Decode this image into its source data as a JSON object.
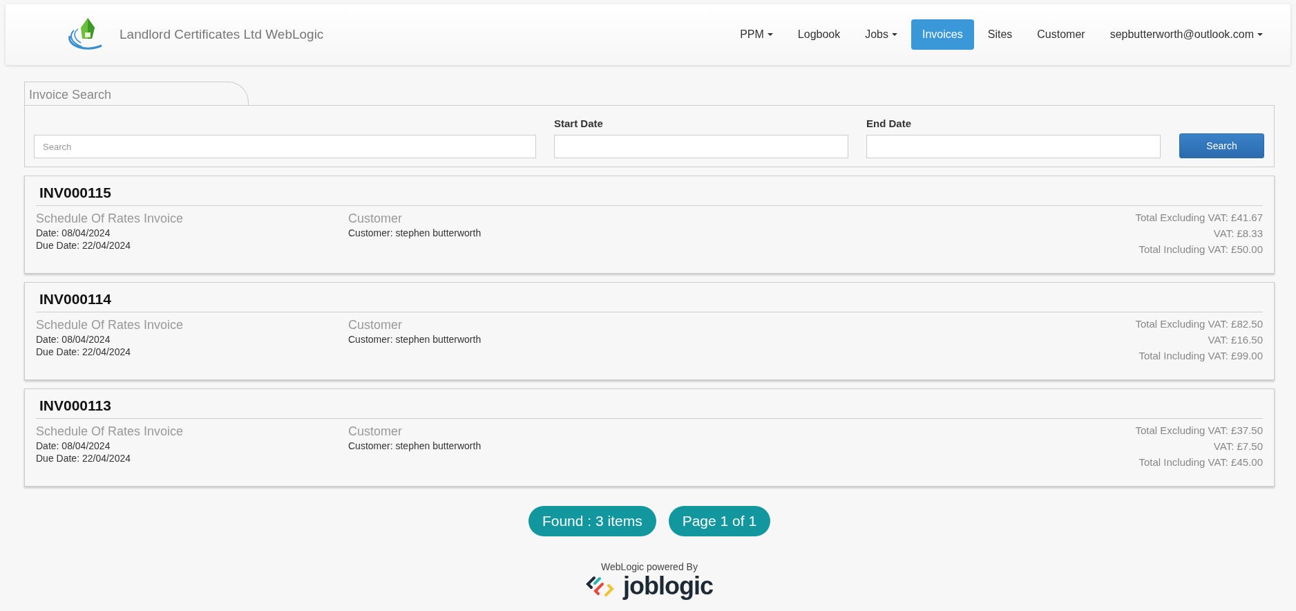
{
  "header": {
    "company": "Landlord Certificates Ltd WebLogic"
  },
  "nav": [
    {
      "label": "PPM",
      "dropdown": true,
      "selected": false
    },
    {
      "label": "Logbook",
      "dropdown": false,
      "selected": false
    },
    {
      "label": "Jobs",
      "dropdown": true,
      "selected": false
    },
    {
      "label": "Invoices",
      "dropdown": false,
      "selected": true
    },
    {
      "label": "Sites",
      "dropdown": false,
      "selected": false
    },
    {
      "label": "Customer",
      "dropdown": false,
      "selected": false
    },
    {
      "label": "sepbutterworth@outlook.com",
      "dropdown": true,
      "selected": false
    }
  ],
  "search_panel": {
    "tab": "Invoice Search",
    "search": {
      "placeholder": "Search"
    },
    "start_date": {
      "label": "Start Date"
    },
    "end_date": {
      "label": "End Date"
    },
    "button": "Search"
  },
  "invoices": [
    {
      "number": "INV000115",
      "type": "Schedule Of Rates Invoice",
      "date": "Date: 08/04/2024",
      "due_date": "Due Date: 22/04/2024",
      "category": "Customer",
      "customer": "Customer: stephen butterworth",
      "total_excl": "Total Excluding VAT: £41.67",
      "vat": "VAT: £8.33",
      "total_incl": "Total Including VAT: £50.00"
    },
    {
      "number": "INV000114",
      "type": "Schedule Of Rates Invoice",
      "date": "Date: 08/04/2024",
      "due_date": "Due Date: 22/04/2024",
      "category": "Customer",
      "customer": "Customer: stephen butterworth",
      "total_excl": "Total Excluding VAT: £82.50",
      "vat": "VAT: £16.50",
      "total_incl": "Total Including VAT: £99.00"
    },
    {
      "number": "INV000113",
      "type": "Schedule Of Rates Invoice",
      "date": "Date: 08/04/2024",
      "due_date": "Due Date: 22/04/2024",
      "category": "Customer",
      "customer": "Customer: stephen butterworth",
      "total_excl": "Total Excluding VAT: £37.50",
      "vat": "VAT: £7.50",
      "total_incl": "Total Including VAT: £45.00"
    }
  ],
  "summary": {
    "found": "Found : 3 items",
    "page": "Page 1 of 1"
  },
  "footer": {
    "powered_by": "WebLogic powered By",
    "brand": "joblogic"
  }
}
